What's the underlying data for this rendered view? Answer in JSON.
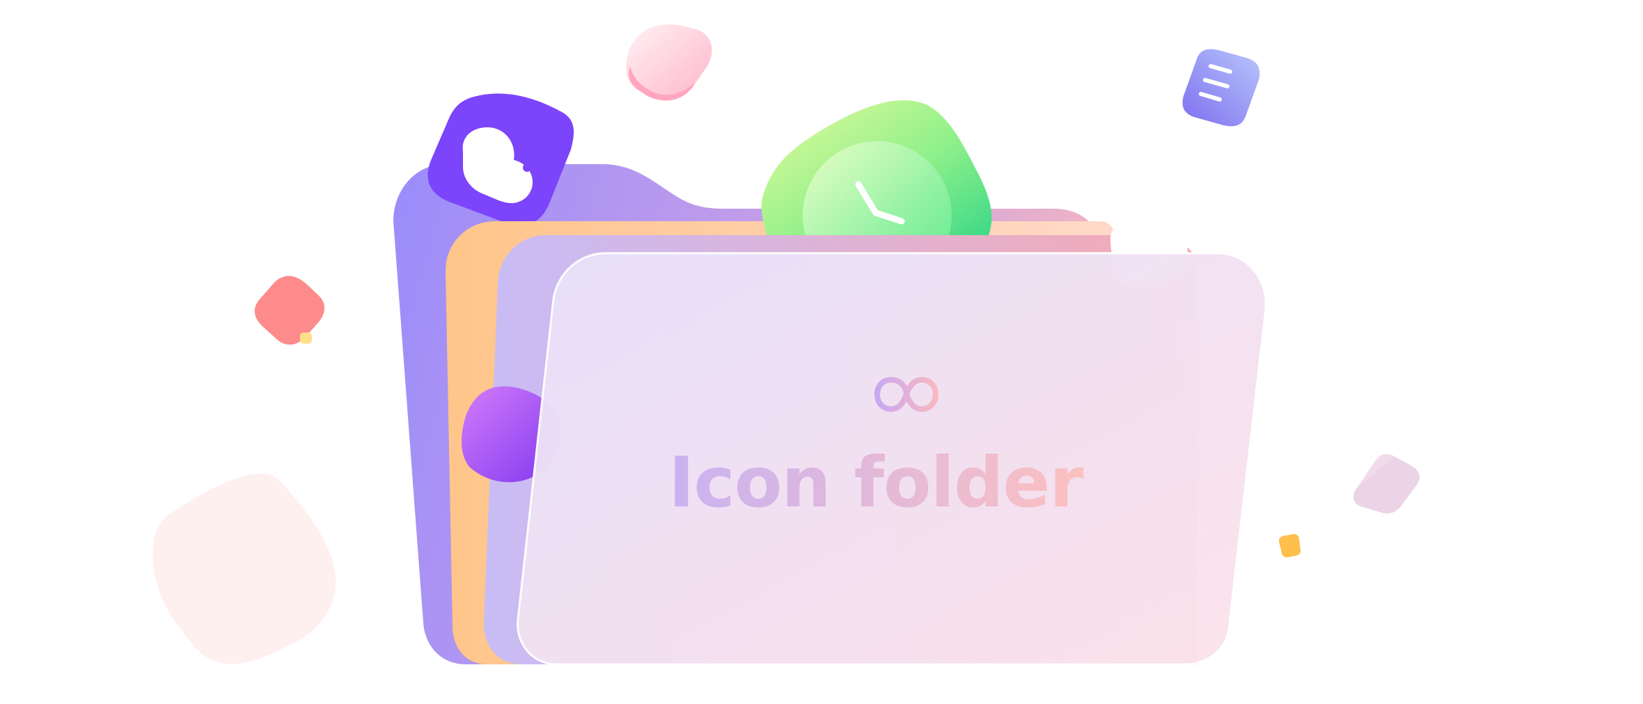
{
  "title": "Icon folder",
  "icons": {
    "top": "infinity-icon",
    "floating": [
      "cloud-icon",
      "clock-icon",
      "document-icon",
      "pink-blob",
      "red-blob",
      "purple-blob",
      "peach-blob",
      "lavender-tile",
      "orange-dot",
      "yellow-dot"
    ]
  },
  "colors": {
    "folder_back": "#9a8cfb",
    "folder_orange": "#ffc58a",
    "folder_lavender": "#c8bcf6",
    "glass_front_start": "#e8e1fb",
    "glass_front_end": "#fce3ea",
    "title_gradient_start": "#c9b2f2",
    "title_gradient_end": "#fcc0c0",
    "cloud_card": "#7c44fb",
    "clock_card_start": "#d8fb98",
    "clock_card_end": "#2fd486",
    "doc_card_start": "#b3c3fb",
    "doc_card_end": "#8a7bf2"
  }
}
